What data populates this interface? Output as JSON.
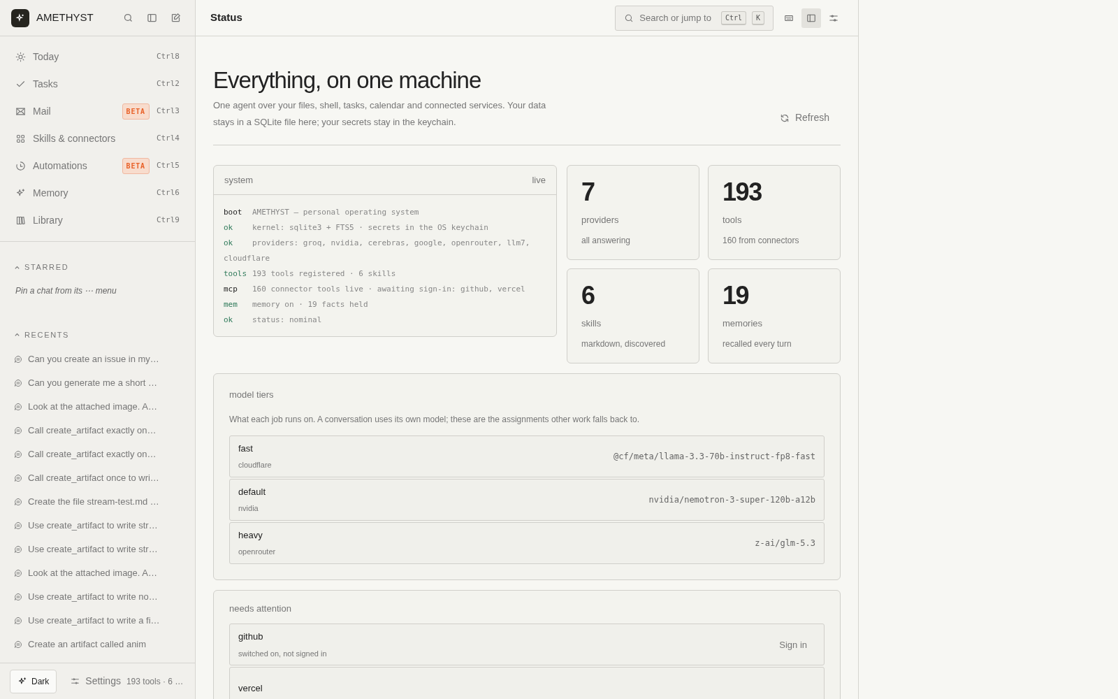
{
  "brand": {
    "name": "AMETHYST"
  },
  "nav": [
    {
      "kind": "sun",
      "label": "Today",
      "shortcut": "Ctrl8"
    },
    {
      "kind": "check",
      "label": "Tasks",
      "shortcut": "Ctrl2"
    },
    {
      "kind": "mail",
      "label": "Mail",
      "badge": "BETA",
      "shortcut": "Ctrl3"
    },
    {
      "kind": "grid",
      "label": "Skills & connectors",
      "shortcut": "Ctrl4"
    },
    {
      "kind": "clock",
      "label": "Automations",
      "badge": "BETA",
      "shortcut": "Ctrl5"
    },
    {
      "kind": "sparkle",
      "label": "Memory",
      "shortcut": "Ctrl6"
    },
    {
      "kind": "books",
      "label": "Library",
      "shortcut": "Ctrl9"
    }
  ],
  "starred": {
    "heading": "STARRED",
    "empty_text": "Pin a chat from its ⋯ menu"
  },
  "recents": {
    "heading": "RECENTS",
    "items": [
      "Can you create an issue in my…",
      "Can you generate me a short …",
      "Look at the attached image. A…",
      "Call create_artifact exactly on…",
      "Call create_artifact exactly on…",
      "Call create_artifact once to wri…",
      "Create the file stream-test.md …",
      "Use create_artifact to write str…",
      "Use create_artifact to write str…",
      "Look at the attached image. A…",
      "Use create_artifact to write no…",
      "Use create_artifact to write a fi…",
      "Create an artifact called anim"
    ]
  },
  "footer": {
    "theme_button": "Dark",
    "settings": "Settings",
    "summary": "193 tools · 6 …"
  },
  "header": {
    "title": "Status",
    "search": {
      "placeholder": "Search or jump to",
      "keys": [
        "Ctrl",
        "K"
      ]
    },
    "view_buttons": [
      {
        "kind": "keyboard",
        "selected": false
      },
      {
        "kind": "panel",
        "selected": true
      },
      {
        "kind": "sliders",
        "selected": false
      }
    ]
  },
  "hero": {
    "title": "Everything, on one machine",
    "description": "One agent over your files, shell, tasks, calendar and connected services. Your data stays in a SQLite file here; your secrets stay in the keychain.",
    "refresh": "Refresh"
  },
  "system": {
    "title": "system",
    "status": "live",
    "lines": [
      {
        "kind": "plain",
        "tag": "boot",
        "text": "AMETHYST — personal operating system"
      },
      {
        "kind": "good",
        "tag": "ok",
        "text": "kernel: sqlite3 + FTS5 · secrets in the OS keychain"
      },
      {
        "kind": "good",
        "tag": "ok",
        "text": "providers: groq, nvidia, cerebras, google, openrouter, llm7, cloudflare"
      },
      {
        "kind": "good",
        "tag": "tools",
        "text": "193 tools registered · 6 skills"
      },
      {
        "kind": "plain",
        "tag": "mcp",
        "text": "160 connector tools live · awaiting sign-in: github, vercel"
      },
      {
        "kind": "good",
        "tag": "mem",
        "text": "memory on · 19 facts held"
      },
      {
        "kind": "good",
        "tag": "ok",
        "text": "status: nominal"
      }
    ]
  },
  "stats": [
    {
      "value": "7",
      "label": "providers",
      "note": "all answering"
    },
    {
      "value": "193",
      "label": "tools",
      "note": "160 from connectors"
    },
    {
      "value": "6",
      "label": "skills",
      "note": "markdown, discovered"
    },
    {
      "value": "19",
      "label": "memories",
      "note": "recalled every turn"
    }
  ],
  "model_tiers": {
    "title": "model tiers",
    "description": "What each job runs on. A conversation uses its own model; these are the assignments other work falls back to.",
    "rows": [
      {
        "name": "fast",
        "provider": "cloudflare",
        "model": "@cf/meta/llama-3.3-70b-instruct-fp8-fast"
      },
      {
        "name": "default",
        "provider": "nvidia",
        "model": "nvidia/nemotron-3-super-120b-a12b"
      },
      {
        "name": "heavy",
        "provider": "openrouter",
        "model": "z-ai/glm-5.3"
      }
    ]
  },
  "attention": {
    "title": "needs attention",
    "rows": [
      {
        "name": "github",
        "detail": "switched on, not signed in",
        "action": "Sign in"
      },
      {
        "name": "vercel"
      }
    ]
  }
}
